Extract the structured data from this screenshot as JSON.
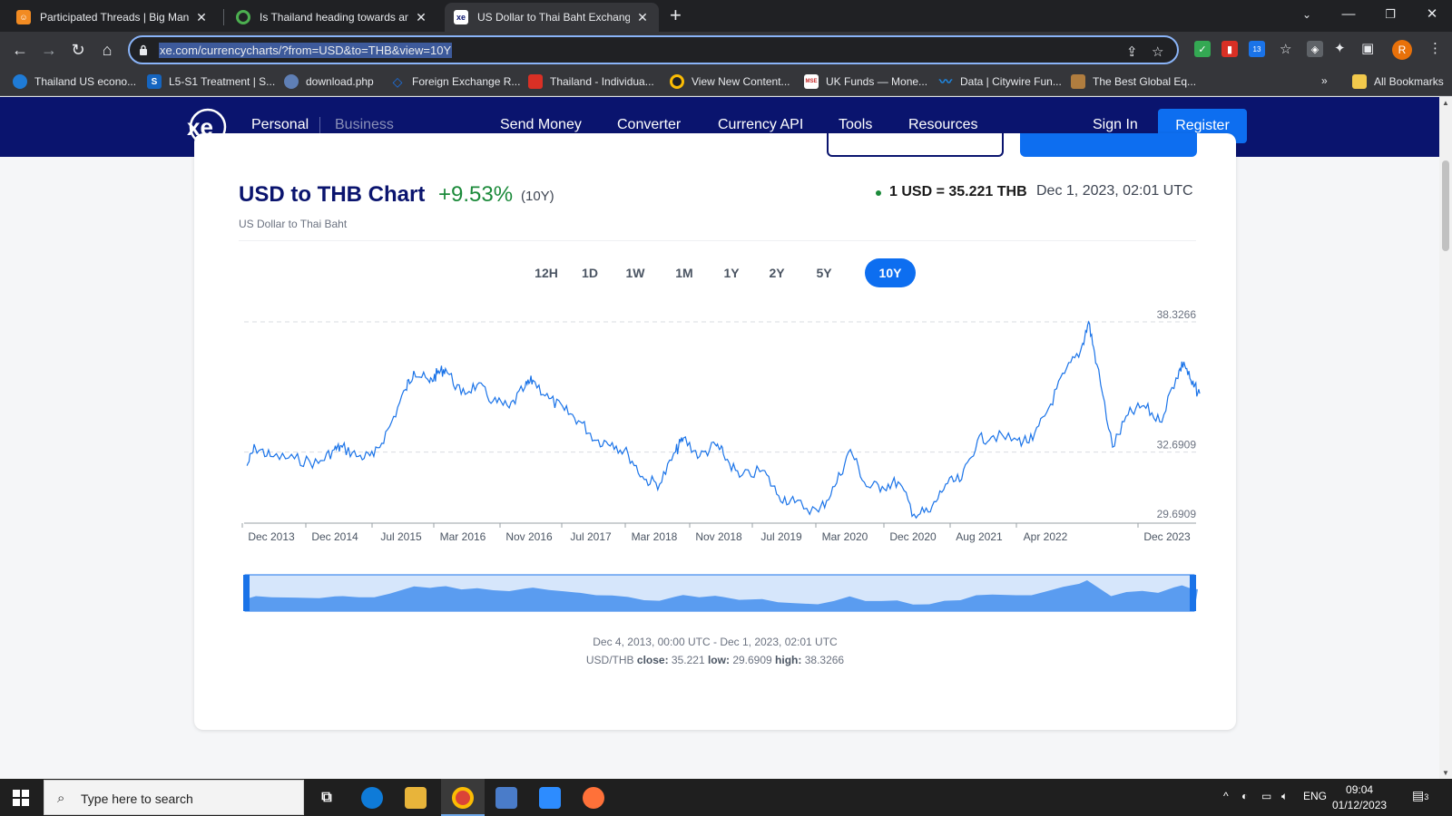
{
  "browser": {
    "tabs": [
      {
        "title": "Participated Threads | Big Mango",
        "icon": "bigmango-icon",
        "color": "#f28b22"
      },
      {
        "title": "Is Thailand heading towards an e",
        "icon": "chrome-icon",
        "color": "#4285f4"
      },
      {
        "title": "US Dollar to Thai Baht Exchange",
        "icon": "xe-icon",
        "color": "#0a146e"
      }
    ],
    "url": "xe.com/currencycharts/?from=USD&to=THB&view=10Y",
    "bookmarks": [
      {
        "label": "Thailand US econo...",
        "icon": "edge-icon",
        "color": "#1f7bd6"
      },
      {
        "label": "L5-S1 Treatment | S...",
        "icon": "s-icon",
        "color": "#1565c0",
        "glyph": "S"
      },
      {
        "label": "download.php",
        "icon": "globe-icon",
        "color": "#8ab4f8"
      },
      {
        "label": "Foreign Exchange R...",
        "icon": "diamond-icon",
        "color": "#1a73e8"
      },
      {
        "label": "Thailand - Individua...",
        "icon": "pwc-icon",
        "color": "#d93025"
      },
      {
        "label": "View New Content...",
        "icon": "chrome-icon",
        "color": "#fbbc04"
      },
      {
        "label": "UK Funds — Mone...",
        "icon": "mse-icon",
        "color": "#c62828",
        "glyph": "MSE"
      },
      {
        "label": "Data | Citywire Fun...",
        "icon": "citywire-icon",
        "color": "#1e88e5"
      },
      {
        "label": "The Best Global Eq...",
        "icon": "flag-icon",
        "color": "#b07d3f"
      }
    ],
    "all_bookmarks": "All Bookmarks",
    "profile_initial": "R",
    "ext_badge": "13"
  },
  "nav": {
    "personal": "Personal",
    "business": "Business",
    "send_money": "Send Money",
    "converter": "Converter",
    "currency_api": "Currency API",
    "tools": "Tools",
    "resources": "Resources",
    "sign_in": "Sign In",
    "register": "Register"
  },
  "header": {
    "title": "USD to THB Chart",
    "change": "+9.53%",
    "period": "(10Y)",
    "subtitle": "US Dollar to Thai Baht",
    "rate": "1 USD = 35.221 THB",
    "timestamp": "Dec 1, 2023, 02:01 UTC"
  },
  "periods": [
    "12H",
    "1D",
    "1W",
    "1M",
    "1Y",
    "2Y",
    "5Y",
    "10Y"
  ],
  "active_period": "10Y",
  "chart_data": {
    "type": "line",
    "title": "USD to THB Chart",
    "y_ticks": [
      "38.3266",
      "32.6909",
      "29.6909"
    ],
    "ylim": [
      29.6909,
      38.3266
    ],
    "x_ticks": [
      "Dec 2013",
      "Dec 2014",
      "Jul 2015",
      "Mar 2016",
      "Nov 2016",
      "Jul 2017",
      "Mar 2018",
      "Nov 2018",
      "Jul 2019",
      "Mar 2020",
      "Dec 2020",
      "Aug 2021",
      "Apr 2022",
      "Dec 2023"
    ],
    "x_start": "2013-12-04",
    "x_end": "2023-12-01",
    "series": [
      {
        "name": "USD/THB",
        "color": "#1a73e8",
        "points": [
          [
            "2013-12",
            32.1
          ],
          [
            "2014-01",
            32.9
          ],
          [
            "2014-03",
            32.5
          ],
          [
            "2014-06",
            32.4
          ],
          [
            "2014-09",
            32.2
          ],
          [
            "2014-11",
            32.8
          ],
          [
            "2014-12",
            32.9
          ],
          [
            "2015-02",
            32.5
          ],
          [
            "2015-04",
            32.5
          ],
          [
            "2015-06",
            33.8
          ],
          [
            "2015-08",
            35.4
          ],
          [
            "2015-09",
            36.2
          ],
          [
            "2015-11",
            35.7
          ],
          [
            "2015-12",
            36.1
          ],
          [
            "2016-01",
            36.3
          ],
          [
            "2016-03",
            35.2
          ],
          [
            "2016-05",
            35.6
          ],
          [
            "2016-07",
            34.9
          ],
          [
            "2016-09",
            34.6
          ],
          [
            "2016-11",
            35.5
          ],
          [
            "2016-12",
            35.8
          ],
          [
            "2017-02",
            35.0
          ],
          [
            "2017-04",
            34.5
          ],
          [
            "2017-06",
            34.0
          ],
          [
            "2017-08",
            33.2
          ],
          [
            "2017-10",
            33.1
          ],
          [
            "2017-12",
            32.6
          ],
          [
            "2018-02",
            31.5
          ],
          [
            "2018-04",
            31.3
          ],
          [
            "2018-06",
            32.7
          ],
          [
            "2018-07",
            33.3
          ],
          [
            "2018-09",
            32.5
          ],
          [
            "2018-11",
            33.0
          ],
          [
            "2018-12",
            32.6
          ],
          [
            "2019-02",
            31.6
          ],
          [
            "2019-05",
            31.9
          ],
          [
            "2019-07",
            30.8
          ],
          [
            "2019-09",
            30.5
          ],
          [
            "2019-12",
            30.1
          ],
          [
            "2020-02",
            31.2
          ],
          [
            "2020-04",
            32.8
          ],
          [
            "2020-06",
            31.2
          ],
          [
            "2020-08",
            31.2
          ],
          [
            "2020-10",
            31.4
          ],
          [
            "2020-12",
            30.0
          ],
          [
            "2021-02",
            30.1
          ],
          [
            "2021-04",
            31.3
          ],
          [
            "2021-06",
            31.5
          ],
          [
            "2021-08",
            33.2
          ],
          [
            "2021-10",
            33.4
          ],
          [
            "2022-01",
            33.2
          ],
          [
            "2022-03",
            33.2
          ],
          [
            "2022-05",
            34.6
          ],
          [
            "2022-07",
            36.1
          ],
          [
            "2022-09",
            37.1
          ],
          [
            "2022-10",
            38.3266
          ],
          [
            "2022-11",
            36.5
          ],
          [
            "2023-01",
            32.9
          ],
          [
            "2023-03",
            34.3
          ],
          [
            "2023-05",
            34.7
          ],
          [
            "2023-07",
            34.0
          ],
          [
            "2023-09",
            35.9
          ],
          [
            "2023-10",
            36.6
          ],
          [
            "2023-11",
            35.6
          ],
          [
            "2023-12",
            35.221
          ]
        ]
      }
    ]
  },
  "footer": {
    "range": "Dec 4, 2013, 00:00 UTC - Dec 1, 2023, 02:01 UTC",
    "pair": "USD/THB",
    "close_label": "close:",
    "close": "35.221",
    "low_label": "low:",
    "low": "29.6909",
    "high_label": "high:",
    "high": "38.3266"
  },
  "taskbar": {
    "search_placeholder": "Type here to search",
    "lang": "ENG",
    "time": "09:04",
    "date": "01/12/2023",
    "notif_count": "3"
  }
}
